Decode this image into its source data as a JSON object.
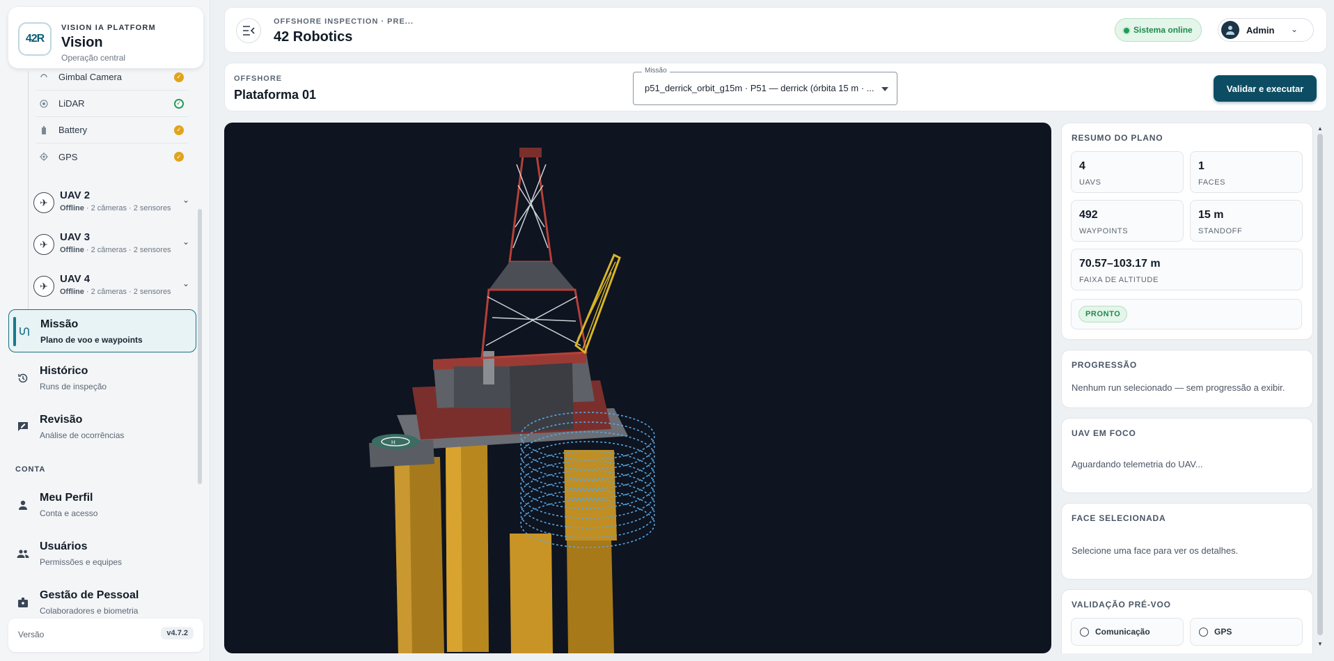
{
  "brand": {
    "logo_text": "42R",
    "platform_label": "VISION IA PLATFORM",
    "title": "Vision",
    "subtitle": "Operação central"
  },
  "sidebar": {
    "sensors": [
      {
        "label": "Gimbal Camera",
        "icon": "camera-icon",
        "status": "warning",
        "status_color": "#e0a41b"
      },
      {
        "label": "LiDAR",
        "icon": "lidar-icon",
        "status": "ok",
        "status_color": "#1f9d55"
      },
      {
        "label": "Battery",
        "icon": "battery-icon",
        "status": "warning",
        "status_color": "#e0a41b"
      },
      {
        "label": "GPS",
        "icon": "gps-icon",
        "status": "warning",
        "status_color": "#e0a41b"
      }
    ],
    "uavs": [
      {
        "name": "UAV 2",
        "status": "Offline",
        "meta": " · 2 câmeras · 2 sensores"
      },
      {
        "name": "UAV 3",
        "status": "Offline",
        "meta": " · 2 câmeras · 2 sensores"
      },
      {
        "name": "UAV 4",
        "status": "Offline",
        "meta": " · 2 câmeras · 2 sensores"
      }
    ],
    "nav": [
      {
        "title": "Missão",
        "sub": "Plano de voo e waypoints",
        "icon": "route-icon",
        "active": true
      },
      {
        "title": "Histórico",
        "sub": "Runs de inspeção",
        "icon": "history-icon",
        "active": false
      },
      {
        "title": "Revisão",
        "sub": "Análise de ocorrências",
        "icon": "review-icon",
        "active": false
      }
    ],
    "account_label": "CONTA",
    "account_nav": [
      {
        "title": "Meu Perfil",
        "sub": "Conta e acesso",
        "icon": "person-icon"
      },
      {
        "title": "Usuários",
        "sub": "Permissões e equipes",
        "icon": "group-icon"
      },
      {
        "title": "Gestão de Pessoal",
        "sub": "Colaboradores e biometria",
        "icon": "badge-icon"
      }
    ],
    "version_label": "Versão",
    "version_value": "v4.7.2"
  },
  "header": {
    "breadcrumb": "OFFSHORE INSPECTION · PRE...",
    "title": "42 Robotics",
    "status": "Sistema online",
    "status_color": "#1f9d55",
    "user": "Admin"
  },
  "mission_bar": {
    "label": "OFFSHORE",
    "platform": "Plataforma 01",
    "select_legend": "Missão",
    "select_value": "p51_derrick_orbit_g15m · P51 — derrick (órbita 15 m · ...",
    "run_button": "Validar e executar",
    "accent": "#0d4d63"
  },
  "plan_summary": {
    "title": "RESUMO DO PLANO",
    "stats": [
      {
        "value": "4",
        "label": "UAVS"
      },
      {
        "value": "1",
        "label": "FACES"
      },
      {
        "value": "492",
        "label": "WAYPOINTS"
      },
      {
        "value": "15 m",
        "label": "STANDOFF"
      }
    ],
    "altitude": {
      "value": "70.57–103.17 m",
      "label": "FAIXA DE ALTITUDE"
    },
    "status_badge": "PRONTO"
  },
  "progress": {
    "title": "PROGRESSÃO",
    "text": "Nenhum run selecionado — sem progressão a exibir."
  },
  "uav_focus": {
    "title": "UAV EM FOCO",
    "text": "Aguardando telemetria do UAV..."
  },
  "face": {
    "title": "FACE SELECIONADA",
    "text": "Selecione uma face para ver os detalhes."
  },
  "preflight": {
    "title": "VALIDAÇÃO PRÉ-VOO",
    "checks": [
      "Comunicação",
      "GPS"
    ]
  }
}
